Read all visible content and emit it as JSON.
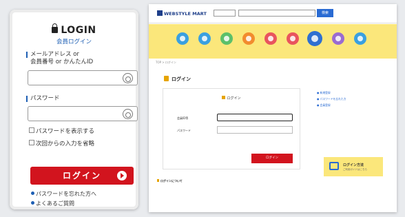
{
  "mobile": {
    "title": "LOGIN",
    "subtitle": "会員ログイン",
    "id_label_1": "メールアドレス or",
    "id_label_2": "会員番号 or かんたんID",
    "password_label": "パスワード",
    "show_password": "パスワードを表示する",
    "remember": "次回からの入力を省略",
    "login_button": "ログイン",
    "forgot_link": "パスワードを忘れた方へ",
    "faq_link": "よくあるご質問"
  },
  "desktop": {
    "logo": "WEBSTYLE MART",
    "breadcrumb": "TOP > ログイン",
    "heading": "ログイン",
    "panel_title": "ログイン",
    "field1_label": "会員ID等",
    "field2_label": "パスワード",
    "login_button": "ログイン",
    "side_links": [
      "● 新規登録",
      "● パスワードを忘れた方",
      "● 会員登録"
    ],
    "promo_title": "ログイン方法",
    "promo_sub": "ご利用ガイドはこちら",
    "note_heading": "ログインについて",
    "search_button": "検索",
    "nav_colors": [
      "#3aa0e0",
      "#3aa0e0",
      "#5cc06a",
      "#f28c2e",
      "#e9545e",
      "#e9545e",
      "#2f6fd1",
      "#9a6bd1",
      "#3aa0e0"
    ]
  }
}
